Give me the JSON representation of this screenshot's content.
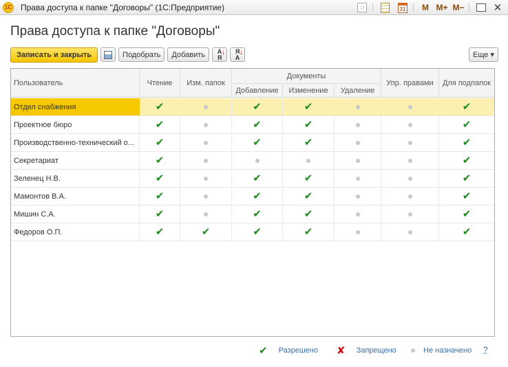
{
  "window": {
    "title": "Права доступа к папке \"Договоры\"  (1С:Предприятие)",
    "logo_text": "1C",
    "calendar_day": "31",
    "m_label": "M",
    "mplus_label": "M+",
    "mminus_label": "M−"
  },
  "form": {
    "title": "Права доступа к папке \"Договоры\""
  },
  "toolbar": {
    "save_close": "Записать и закрыть",
    "pick": "Подобрать",
    "add": "Добавить",
    "sort_label": "А\nЯ",
    "more": "Еще ▾"
  },
  "table": {
    "headers": {
      "user": "Пользователь",
      "read": "Чтение",
      "edit_folders": "Изм. папок",
      "documents": "Документы",
      "add": "Добавление",
      "change": "Изменение",
      "delete": "Удаление",
      "manage_rights": "Упр. правами",
      "subfolders": "Для подпапок"
    },
    "rows": [
      {
        "name": "Отдел снабжения",
        "rights": [
          "check",
          "dot",
          "check",
          "check",
          "dot",
          "dot",
          "check"
        ],
        "selected": true
      },
      {
        "name": "Проектное бюро",
        "rights": [
          "check",
          "dot",
          "check",
          "check",
          "dot",
          "dot",
          "check"
        ],
        "selected": false
      },
      {
        "name": "Производственно-технический о...",
        "rights": [
          "check",
          "dot",
          "check",
          "check",
          "dot",
          "dot",
          "check"
        ],
        "selected": false
      },
      {
        "name": "Секретариат",
        "rights": [
          "check",
          "dot",
          "dot",
          "dot",
          "dot",
          "dot",
          "check"
        ],
        "selected": false
      },
      {
        "name": "Зеленец Н.В.",
        "rights": [
          "check",
          "dot",
          "check",
          "check",
          "dot",
          "dot",
          "check"
        ],
        "selected": false
      },
      {
        "name": "Мамонтов В.А.",
        "rights": [
          "check",
          "dot",
          "check",
          "check",
          "dot",
          "dot",
          "check"
        ],
        "selected": false
      },
      {
        "name": "Мишин С.А.",
        "rights": [
          "check",
          "dot",
          "check",
          "check",
          "dot",
          "dot",
          "check"
        ],
        "selected": false
      },
      {
        "name": "Федоров О.П.",
        "rights": [
          "check",
          "check",
          "check",
          "check",
          "dot",
          "dot",
          "check"
        ],
        "selected": false
      }
    ]
  },
  "legend": {
    "allowed": "Разрешено",
    "denied": "Запрещено",
    "not_assigned": "Не назначено",
    "help": "?"
  },
  "colors": {
    "allowed": "#1e8a1e",
    "denied": "#d41111",
    "not_assigned": "#c8c8c8",
    "accent": "#f5c400"
  }
}
